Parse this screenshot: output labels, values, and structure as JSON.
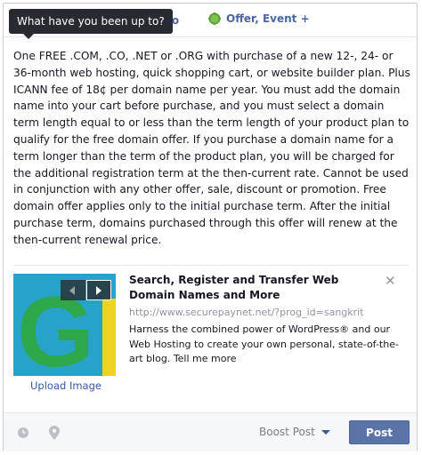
{
  "tooltip": {
    "text": "What have you been up to?"
  },
  "tabs": {
    "video_label": "ideo",
    "offer_label": "Offer, Event +",
    "offer_icon": "gear-badge-icon"
  },
  "post": {
    "body": "One FREE .COM, .CO, .NET or .ORG with purchase of a new 12-, 24- or 36-month web hosting, quick shopping cart, or website builder plan. Plus ICANN fee of 18¢ per domain name per year. You must add the domain name into your cart before purchase, and you must select a domain term length equal to or less than the term length of your product plan to qualify for the free domain offer. If you purchase a domain name for a term longer than the term of the product plan, you will be charged for the additional registration term at the then-current rate. Cannot be used in conjunction with any other offer, sale, discount or promotion. Free domain offer applies only to the initial purchase term. After the initial purchase term, domains purchased through this offer will renew at the then-current renewal price."
  },
  "link_preview": {
    "title": "Search, Register and Transfer Web Domain Names and More",
    "url": "http://www.securepaynet.net/?prog_id=sangkrit",
    "description": "Harness the combined power of WordPress® and our Web Hosting to create your own personal, state-of-the-art blog. Tell me more",
    "upload_label": "Upload Image",
    "close_glyph": "✕"
  },
  "footer": {
    "boost_label": "Boost Post",
    "post_label": "Post",
    "icons": [
      "clock-icon",
      "location-pin-icon"
    ]
  },
  "colors": {
    "link_blue": "#3b5998",
    "post_button": "#5b74a8",
    "tooltip_bg": "#272a30",
    "offer_icon_green": "#5a9e3a"
  }
}
